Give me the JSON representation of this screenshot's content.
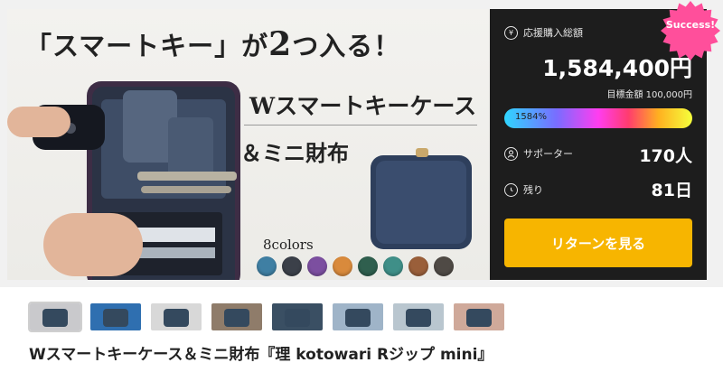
{
  "hero": {
    "title_open": "「スマートキー」が",
    "title_num": "2",
    "title_close": "つ入る！",
    "subtitle1": "Wスマートキーケース",
    "subtitle2": "＆ミニ財布",
    "colors_label": "8colors",
    "swatches": [
      "#3f7fa3",
      "#3b4049",
      "#7c4fa0",
      "#d98a3c",
      "#2f5f4e",
      "#3f8f88",
      "#9a5f3a",
      "#4f4a45"
    ]
  },
  "badge": {
    "text": "Success!",
    "color": "#ff4f9b"
  },
  "stats": {
    "total_label": "応援購入総額",
    "amount": "1,584,400円",
    "goal": "目標金額 100,000円",
    "progress_text": "1584%",
    "progress_percent": 1584,
    "supporters_label": "サポーター",
    "supporters_value": "170人",
    "remaining_label": "残り",
    "remaining_value": "81日",
    "cta_label": "リターンを見る",
    "yen_icon_glyph": "¥"
  },
  "thumbnails": [
    {
      "icon": "product-thumbnail",
      "color": "#c9c9cc",
      "active": true
    },
    {
      "icon": "product-thumbnail",
      "color": "#2f6fb0",
      "active": false
    },
    {
      "icon": "product-thumbnail",
      "color": "#d8d8d8",
      "active": false
    },
    {
      "icon": "product-thumbnail",
      "color": "#8f7c6a",
      "active": false
    },
    {
      "icon": "product-thumbnail",
      "color": "#3a4f63",
      "active": false
    },
    {
      "icon": "product-thumbnail",
      "color": "#9fb4c8",
      "active": false
    },
    {
      "icon": "product-thumbnail",
      "color": "#b9c6cf",
      "active": false
    },
    {
      "icon": "product-thumbnail",
      "color": "#cfa99a",
      "active": false
    }
  ],
  "product": {
    "title": "Wスマートキーケース＆ミニ財布『理 kotowari Rジップ mini』"
  }
}
